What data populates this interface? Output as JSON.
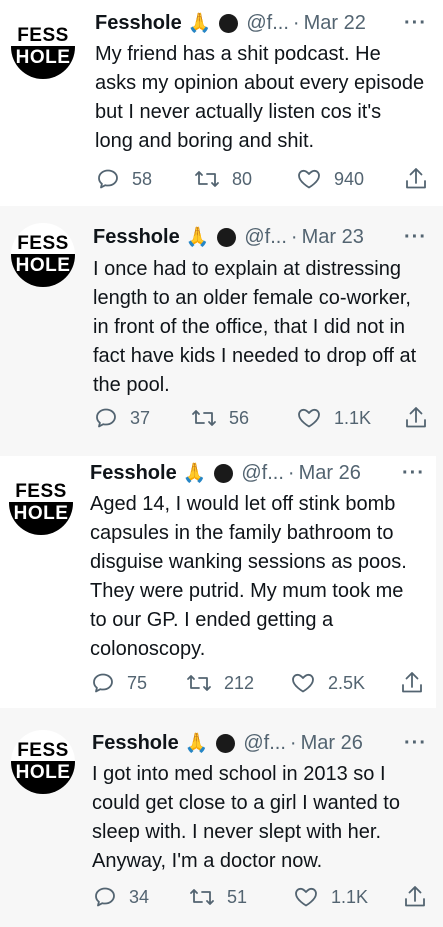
{
  "tweets": [
    {
      "avatar_top": "FESS",
      "avatar_bottom": "HOLE",
      "name": "Fesshole",
      "emoji": "🙏",
      "handle": "@f...",
      "date": "Mar 22",
      "more": "···",
      "text_lines": [
        "My friend has a shit podcast. He",
        "asks my opinion about every episode",
        "but I never actually listen cos it's",
        "long and boring and shit."
      ],
      "replies": "58",
      "retweets": "80",
      "likes": "940"
    },
    {
      "avatar_top": "FESS",
      "avatar_bottom": "HOLE",
      "name": "Fesshole",
      "emoji": "🙏",
      "handle": "@f...",
      "date": "Mar 23",
      "more": "···",
      "text_lines": [
        "I once had to explain at distressing",
        "length to an older female co-worker,",
        "in front of the office, that I did not in",
        "fact have kids I needed to drop off at",
        "the pool."
      ],
      "replies": "37",
      "retweets": "56",
      "likes": "1.1K"
    },
    {
      "avatar_top": "FESS",
      "avatar_bottom": "HOLE",
      "name": "Fesshole",
      "emoji": "🙏",
      "handle": "@f...",
      "date": "Mar 26",
      "more": "···",
      "text_lines": [
        "Aged 14, I would let off stink bomb",
        "capsules in the family bathroom to",
        "disguise wanking sessions as poos.",
        "They were putrid. My mum took me",
        "to our GP. I ended getting a",
        "colonoscopy."
      ],
      "replies": "75",
      "retweets": "212",
      "likes": "2.5K"
    },
    {
      "avatar_top": "FESS",
      "avatar_bottom": "HOLE",
      "name": "Fesshole",
      "emoji": "🙏",
      "handle": "@f...",
      "date": "Mar 26",
      "more": "···",
      "text_lines": [
        "I got into med school in 2013 so I",
        "could get close to a girl I wanted to",
        "sleep with. I never slept with her.",
        "Anyway, I'm a doctor now."
      ],
      "replies": "34",
      "retweets": "51",
      "likes": "1.1K"
    }
  ],
  "icons": [
    "reply-icon",
    "retweet-icon",
    "like-icon",
    "share-icon"
  ],
  "colors": {
    "text": "#0f1419",
    "secondary": "#536471",
    "alt_background": "#f7f7f7"
  }
}
